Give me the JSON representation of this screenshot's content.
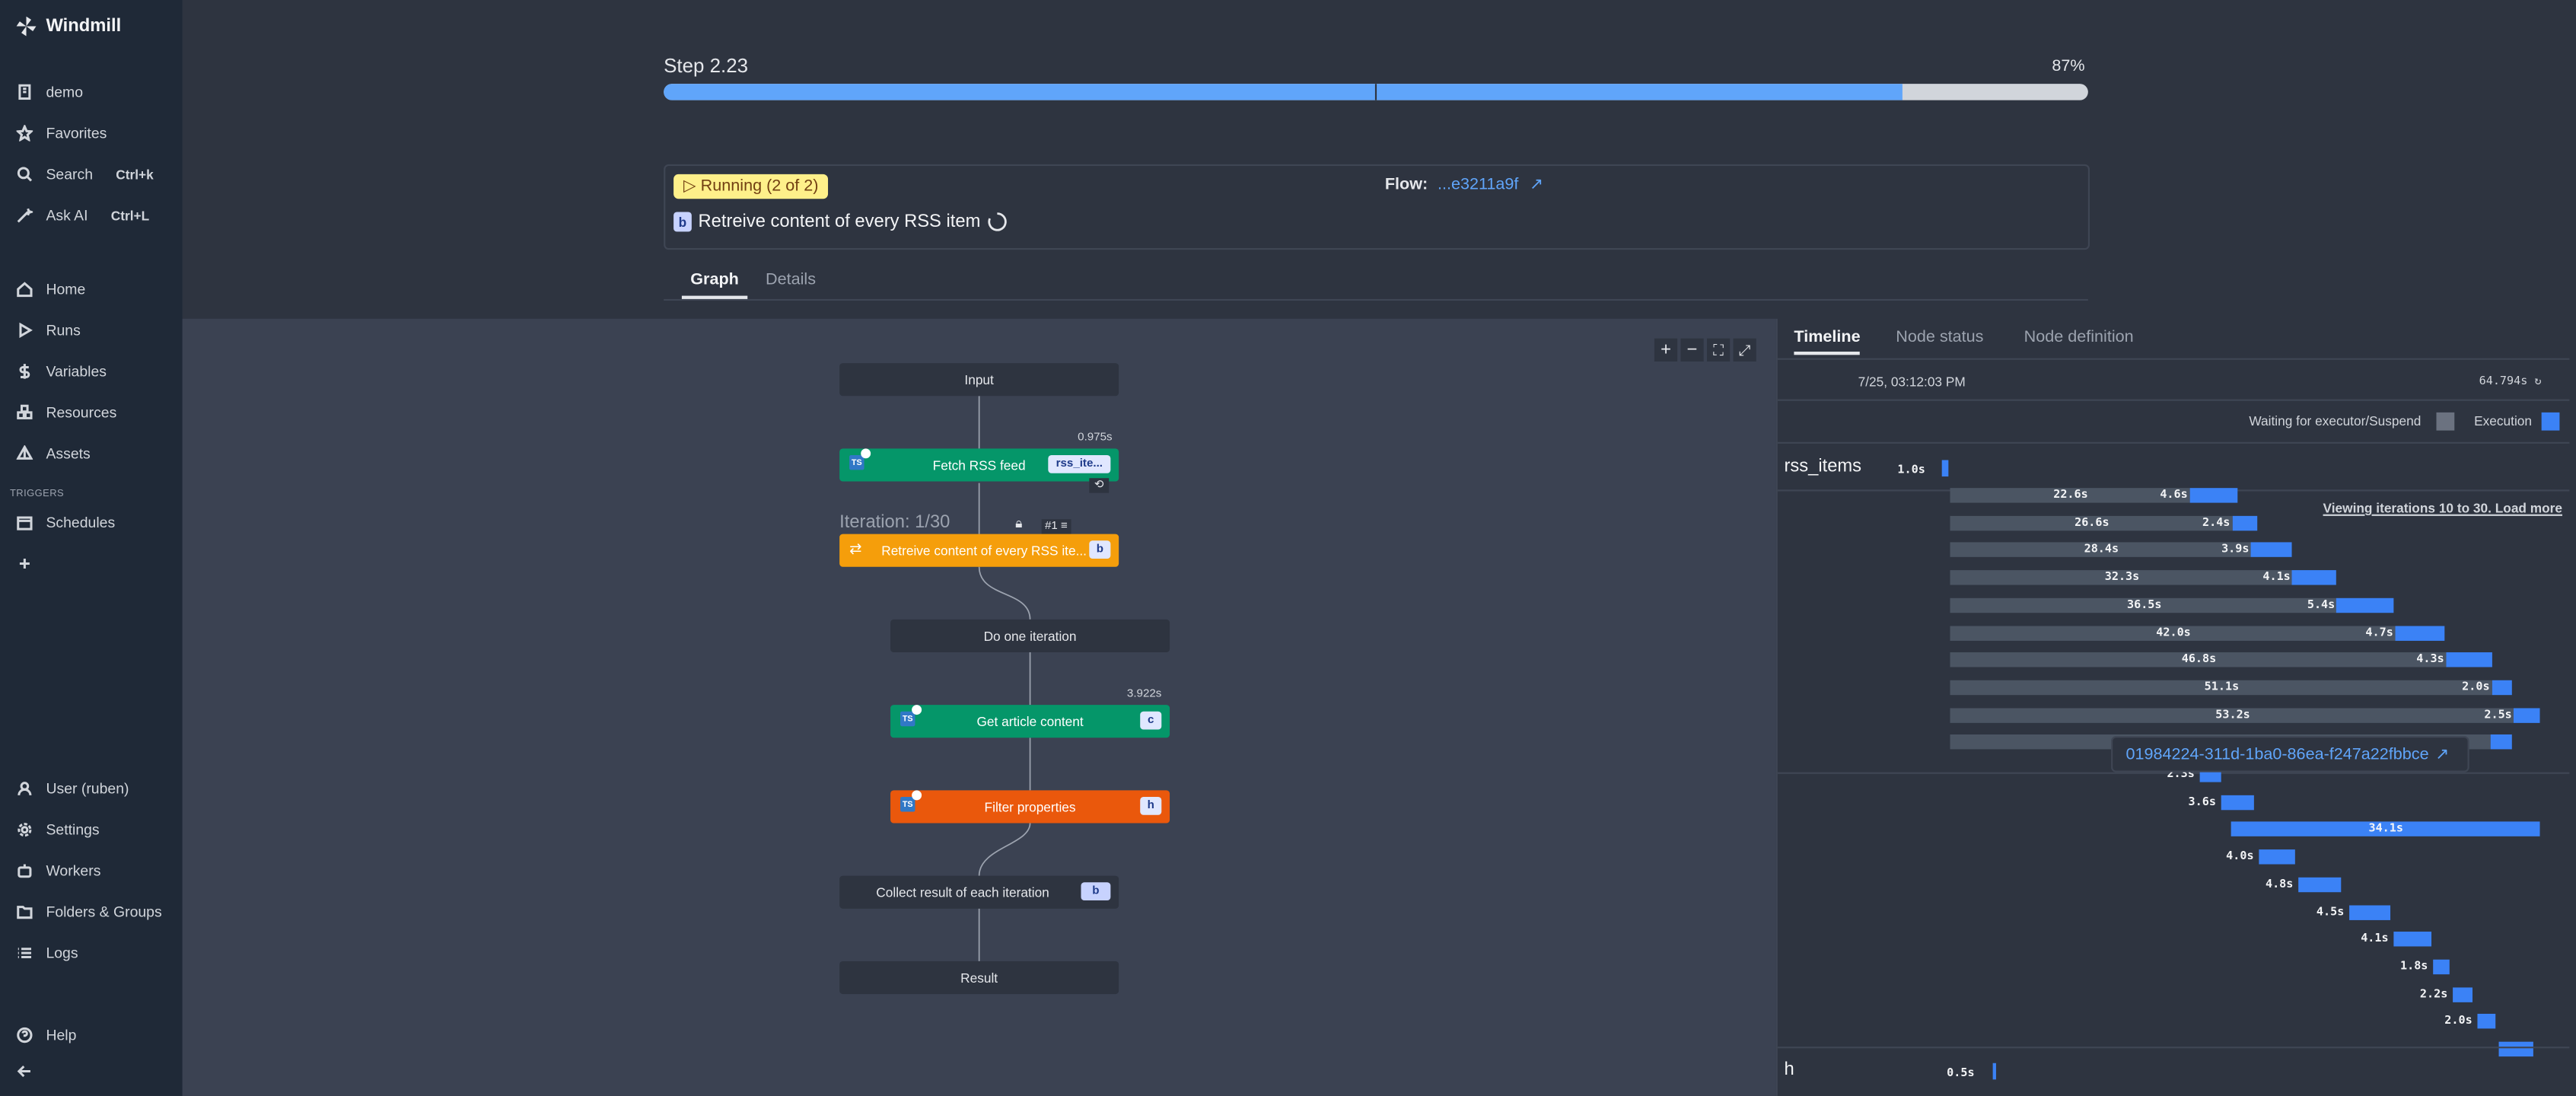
{
  "sidebar": {
    "brand": "Windmill",
    "top_items": [
      {
        "label": "demo",
        "icon": "building-icon"
      },
      {
        "label": "Favorites",
        "icon": "star-icon"
      },
      {
        "label": "Search",
        "icon": "search-icon",
        "shortcut": "Ctrl+k"
      },
      {
        "label": "Ask AI",
        "icon": "wand-icon",
        "shortcut": "Ctrl+L"
      }
    ],
    "main_items": [
      {
        "label": "Home",
        "icon": "home-icon"
      },
      {
        "label": "Runs",
        "icon": "play-icon"
      },
      {
        "label": "Variables",
        "icon": "dollar-icon"
      },
      {
        "label": "Resources",
        "icon": "boxes-icon"
      },
      {
        "label": "Assets",
        "icon": "pyramid-icon"
      }
    ],
    "triggers_label": "TRIGGERS",
    "trigger_items": [
      {
        "label": "Schedules",
        "icon": "calendar-icon"
      }
    ],
    "bottom_items": [
      {
        "label": "User (ruben)",
        "icon": "user-icon"
      },
      {
        "label": "Settings",
        "icon": "gear-icon"
      },
      {
        "label": "Workers",
        "icon": "bot-icon"
      },
      {
        "label": "Folders & Groups",
        "icon": "folder-icon"
      },
      {
        "label": "Logs",
        "icon": "list-icon"
      }
    ],
    "help": "Help"
  },
  "header": {
    "step_label": "Step 2.23",
    "progress_percent": "87%",
    "progress_value": 0.87,
    "running_badge": "Running (2 of 2)",
    "flow_label": "Flow:",
    "flow_id": "...e3211a9f",
    "node_badge": "b",
    "node_title": "Retreive content of every RSS item",
    "tabs": [
      "Graph",
      "Details"
    ]
  },
  "graph": {
    "nodes": {
      "input": "Input",
      "fetch": "Fetch RSS feed",
      "fetch_tag": "rss_ite...",
      "fetch_duration": "0.975s",
      "iteration_label": "Iteration: 1/30",
      "iteration_index": "#1",
      "loop": "Retreive content of every RSS ite...",
      "loop_tag": "b",
      "do_one": "Do one iteration",
      "article": "Get article content",
      "article_tag": "c",
      "article_duration": "3.922s",
      "filter": "Filter properties",
      "filter_tag": "h",
      "collect": "Collect result of each iteration",
      "collect_tag": "b",
      "result": "Result"
    },
    "ts_label": "TS"
  },
  "panel": {
    "tabs": [
      "Timeline",
      "Node status",
      "Node definition"
    ],
    "start_time": "7/25, 03:12:03 PM",
    "total_duration": "64.794s",
    "legend_waiting": "Waiting for executor/Suspend",
    "legend_execution": "Execution",
    "rss_label": "rss_items",
    "rss_duration": "1.0s",
    "load_more": "Viewing iterations 10 to 30. Load more",
    "tooltip_job": "01984224-311d-1ba0-86ea-f247a22fbbce",
    "h_label": "h",
    "h_duration": "0.5s",
    "colors": {
      "waiting": "#4b5563",
      "execution": "#3b82f6"
    }
  },
  "chart_data": {
    "type": "bar",
    "title": "",
    "iterations_b": [
      {
        "wait": "22.6s",
        "exec": "4.6s"
      },
      {
        "wait": "26.6s",
        "exec": "2.4s"
      },
      {
        "wait": "28.4s",
        "exec": "3.9s"
      },
      {
        "wait": "32.3s",
        "exec": "4.1s"
      },
      {
        "wait": "36.5s",
        "exec": "5.4s"
      },
      {
        "wait": "42.0s",
        "exec": "4.7s"
      },
      {
        "wait": "46.8s",
        "exec": "4.3s"
      },
      {
        "wait": "51.1s",
        "exec": "2.0s"
      },
      {
        "wait": "53.2s",
        "exec": "2.5s"
      },
      {
        "wait": "",
        "exec": ""
      }
    ],
    "iterations_c": [
      "2.3s",
      "3.6s",
      "34.1s",
      "4.0s",
      "4.8s",
      "4.5s",
      "4.1s",
      "1.8s",
      "2.2s",
      "2.0s",
      ""
    ]
  }
}
